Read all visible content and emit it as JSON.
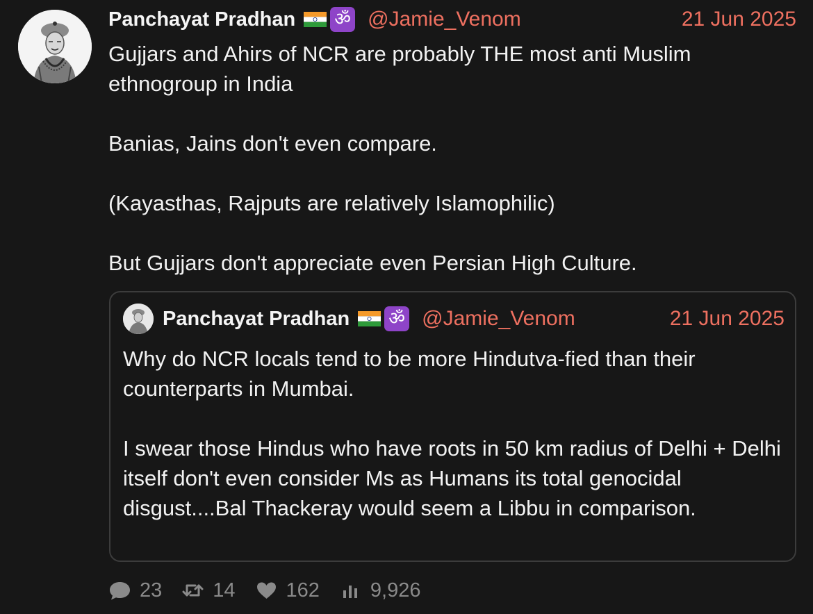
{
  "tweet": {
    "author_name": "Panchayat Pradhan",
    "handle": "@Jamie_Venom",
    "date": "21 Jun 2025",
    "emoji_flag": "india-flag-icon",
    "emoji_om": "ॐ",
    "paragraphs": [
      "Gujjars and Ahirs of NCR are probably THE most anti Muslim ethnogroup in India",
      "Banias, Jains don't even compare.",
      "(Kayasthas, Rajputs are relatively Islamophilic)",
      "But Gujjars don't appreciate even Persian High Culture."
    ]
  },
  "quoted_tweet": {
    "author_name": "Panchayat Pradhan",
    "handle": "@Jamie_Venom",
    "date": "21 Jun 2025",
    "emoji_om": "ॐ",
    "paragraphs": [
      "Why do NCR locals tend to be more Hindutva-fied than their counterparts in Mumbai.",
      "I swear those Hindus who have roots in 50 km radius of Delhi + Delhi itself don't even consider Ms as Humans its total genocidal disgust....Bal Thackeray would seem a Libbu in comparison."
    ]
  },
  "stats": {
    "replies": "23",
    "retweets": "14",
    "likes": "162",
    "views": "9,926"
  },
  "colors": {
    "background": "#171717",
    "accent_handle": "#ee7060",
    "muted": "#8a8a8a",
    "om_badge": "#8e44c8"
  }
}
